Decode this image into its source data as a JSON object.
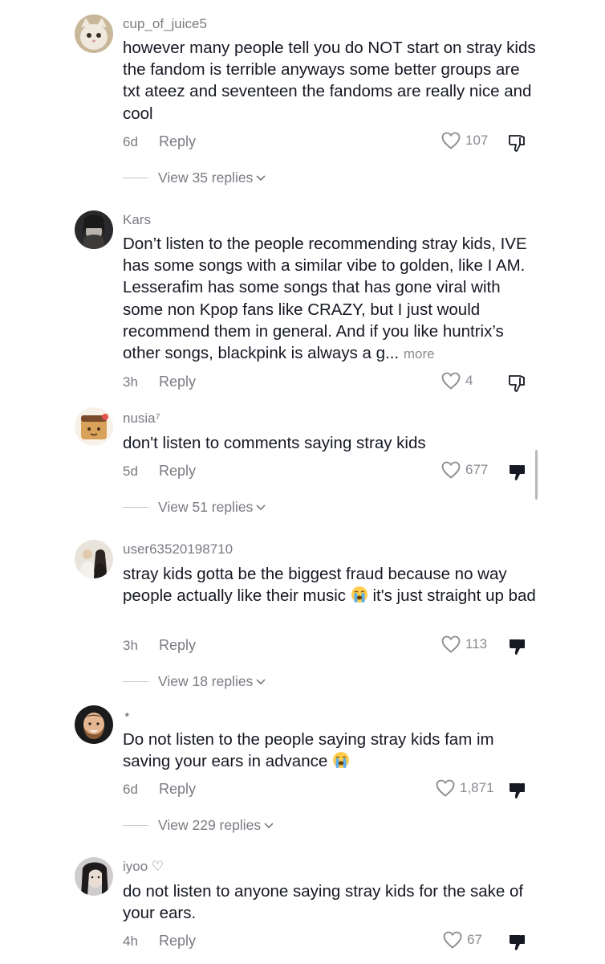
{
  "comments": [
    {
      "username": "cup_of_juice5",
      "text": "however many people tell you do NOT start on stray kids the fandom is terrible anyways some better groups are txt ateez and seventeen the fandoms are really nice and cool",
      "time": "6d",
      "reply_label": "Reply",
      "likes": "107",
      "disliked": false,
      "view_replies": "View 35 replies"
    },
    {
      "username": "Kars",
      "text": "Don’t listen to the people recommending stray kids, IVE has some songs with a similar vibe to golden, like I AM. Lesserafim has some songs that has gone viral with some non Kpop fans like CRAZY, but I just would recommend them in general. And if you like huntrix’s other songs, blackpink is always a g...",
      "more_label": "more",
      "time": "3h",
      "reply_label": "Reply",
      "likes": "4",
      "disliked": false
    },
    {
      "username": "nusia⁷",
      "text": "don't listen to comments saying stray kids",
      "time": "5d",
      "reply_label": "Reply",
      "likes": "677",
      "disliked": true,
      "view_replies": "View 51 replies"
    },
    {
      "username": "user63520198710",
      "text_before_emoji": "stray kids gotta be the biggest fraud because no way people actually like their music",
      "emoji": "loudly-crying-face",
      "text_after_emoji": "it's just straight up bad",
      "time": "3h",
      "reply_label": "Reply",
      "likes": "113",
      "disliked": true,
      "view_replies": "View 18 replies"
    },
    {
      "username": "⋆",
      "text_before_emoji": "Do not listen to the people saying stray kids fam im saving your ears in advance",
      "emoji": "loudly-crying-face",
      "time": "6d",
      "reply_label": "Reply",
      "likes": "1,871",
      "disliked": true,
      "view_replies": "View 229 replies"
    },
    {
      "username": "iyoo ♡",
      "text": "do not listen to anyone saying stray kids for the sake of your ears.",
      "time": "4h",
      "reply_label": "Reply",
      "likes": "67",
      "disliked": true
    }
  ],
  "colors": {
    "text": "#161823",
    "muted": "#7a7b82",
    "icon": "#8a8b91",
    "dislike_filled": "#161823"
  }
}
